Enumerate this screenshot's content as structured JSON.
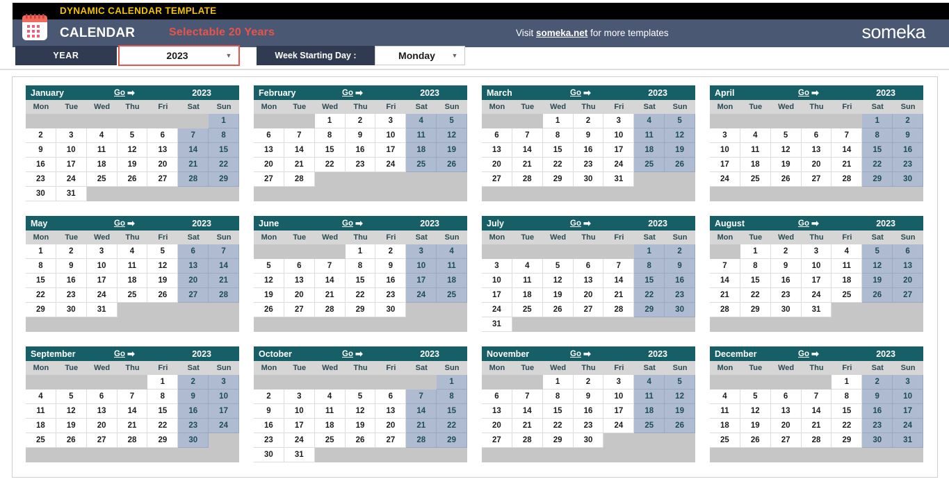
{
  "banner": {
    "tagline": "DYNAMIC CALENDAR TEMPLATE",
    "app_title": "CALENDAR",
    "subtitle": "Selectable 20 Years",
    "visit_prefix": "Visit ",
    "visit_link": "someka.net",
    "visit_suffix": " for more templates",
    "logo": "someka",
    "icon": "calendar-icon",
    "colors": {
      "banner_black": "#000000",
      "banner_slate": "#4a5873",
      "tagline_yellow": "#f2c200",
      "subtitle_red": "#e8544a",
      "month_header_teal": "#175f67",
      "weekend_blue": "#aebbd1",
      "control_navy": "#303a50"
    }
  },
  "controls": {
    "year_label": "YEAR",
    "year_value": "2023",
    "year_placeholder": "2023",
    "week_start_label": "Week Starting Day :",
    "week_start_value": "Monday",
    "dropdown_icon": "chevron-down-icon"
  },
  "calendar": {
    "year": "2023",
    "go_label": "Go",
    "go_arrow": "➡",
    "weekdays": [
      "Mon",
      "Tue",
      "Wed",
      "Thu",
      "Fri",
      "Sat",
      "Sun"
    ],
    "weekend_indices": [
      5,
      6
    ],
    "months": [
      {
        "name": "January",
        "year": "2023",
        "lead_blanks": 6,
        "days": 31,
        "rows": 6
      },
      {
        "name": "February",
        "year": "2023",
        "lead_blanks": 2,
        "days": 28,
        "rows": 6
      },
      {
        "name": "March",
        "year": "2023",
        "lead_blanks": 2,
        "days": 31,
        "rows": 6
      },
      {
        "name": "April",
        "year": "2023",
        "lead_blanks": 5,
        "days": 30,
        "rows": 6
      },
      {
        "name": "May",
        "year": "2023",
        "lead_blanks": 0,
        "days": 31,
        "rows": 6
      },
      {
        "name": "June",
        "year": "2023",
        "lead_blanks": 3,
        "days": 30,
        "rows": 6
      },
      {
        "name": "July",
        "year": "2023",
        "lead_blanks": 5,
        "days": 31,
        "rows": 6
      },
      {
        "name": "August",
        "year": "2023",
        "lead_blanks": 1,
        "days": 31,
        "rows": 6
      },
      {
        "name": "September",
        "year": "2023",
        "lead_blanks": 4,
        "days": 30,
        "rows": 6
      },
      {
        "name": "October",
        "year": "2023",
        "lead_blanks": 6,
        "days": 31,
        "rows": 6
      },
      {
        "name": "November",
        "year": "2023",
        "lead_blanks": 2,
        "days": 30,
        "rows": 6
      },
      {
        "name": "December",
        "year": "2023",
        "lead_blanks": 4,
        "days": 31,
        "rows": 6
      }
    ]
  }
}
